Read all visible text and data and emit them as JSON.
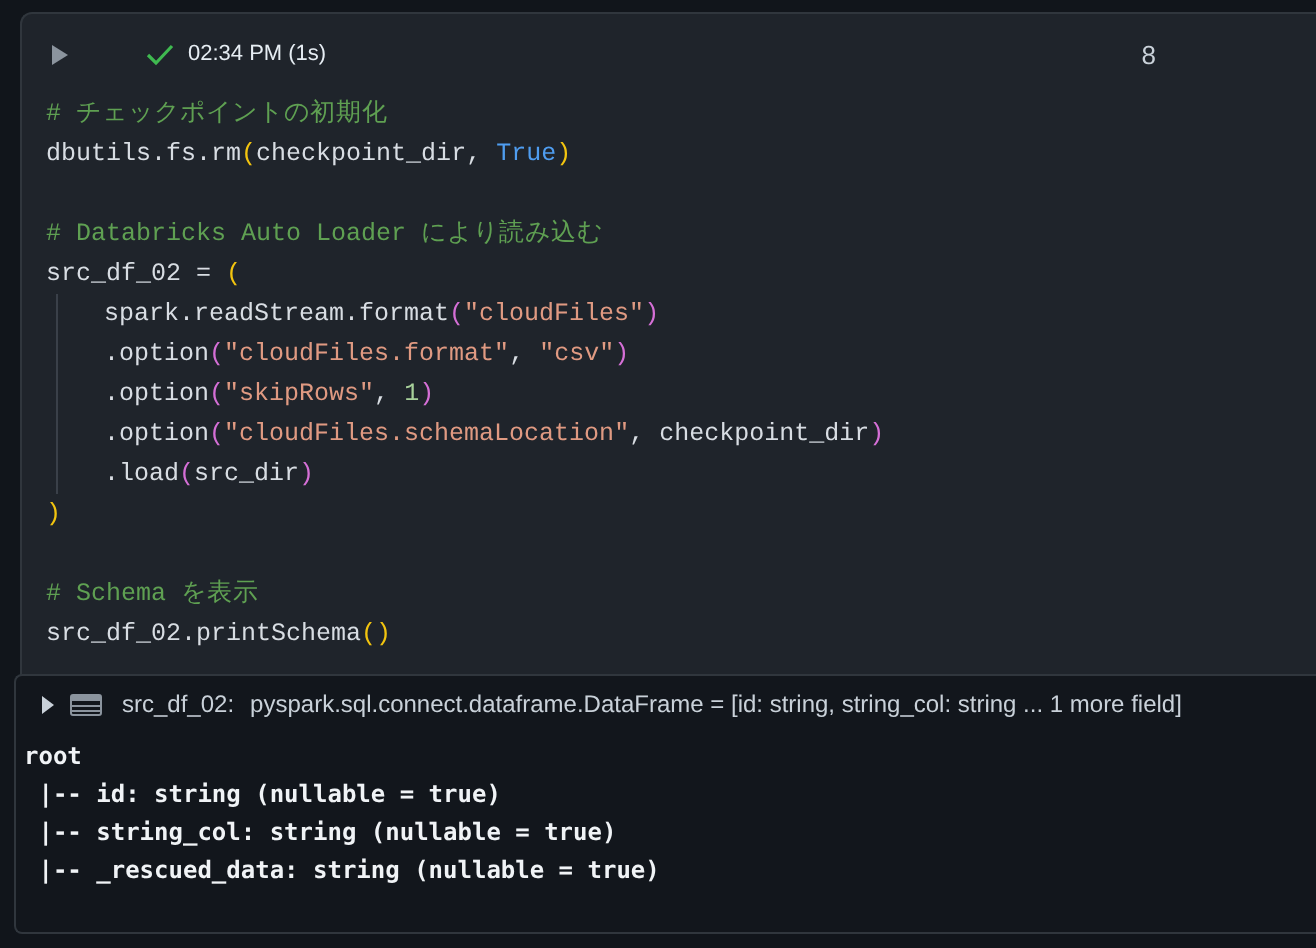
{
  "cell": {
    "succeeded": true,
    "run_time": "02:34 PM (1s)",
    "cell_number": "8",
    "code_lines": [
      {
        "kind": "code",
        "indent": false,
        "tokens": [
          {
            "kind": "comment",
            "text": "# チェックポイントの初期化"
          }
        ]
      },
      {
        "kind": "code",
        "indent": false,
        "tokens": [
          {
            "kind": "plain",
            "text": "dbutils.fs.rm"
          },
          {
            "kind": "paren",
            "text": "("
          },
          {
            "kind": "plain",
            "text": "checkpoint_dir, "
          },
          {
            "kind": "keyword",
            "text": "True"
          },
          {
            "kind": "paren",
            "text": ")"
          }
        ]
      },
      {
        "kind": "blank"
      },
      {
        "kind": "code",
        "indent": false,
        "tokens": [
          {
            "kind": "comment",
            "text": "# Databricks Auto Loader により読み込む"
          }
        ]
      },
      {
        "kind": "code",
        "indent": false,
        "tokens": [
          {
            "kind": "plain",
            "text": "src_df_02 = "
          },
          {
            "kind": "paren",
            "text": "("
          }
        ]
      },
      {
        "kind": "code",
        "indent": true,
        "tokens": [
          {
            "kind": "plain",
            "text": "spark.readStream.format"
          },
          {
            "kind": "paren2",
            "text": "("
          },
          {
            "kind": "string",
            "text": "\"cloudFiles\""
          },
          {
            "kind": "paren2",
            "text": ")"
          }
        ]
      },
      {
        "kind": "code",
        "indent": true,
        "tokens": [
          {
            "kind": "plain",
            "text": ".option"
          },
          {
            "kind": "paren2",
            "text": "("
          },
          {
            "kind": "string",
            "text": "\"cloudFiles.format\""
          },
          {
            "kind": "plain",
            "text": ", "
          },
          {
            "kind": "string",
            "text": "\"csv\""
          },
          {
            "kind": "paren2",
            "text": ")"
          }
        ]
      },
      {
        "kind": "code",
        "indent": true,
        "tokens": [
          {
            "kind": "plain",
            "text": ".option"
          },
          {
            "kind": "paren2",
            "text": "("
          },
          {
            "kind": "string",
            "text": "\"skipRows\""
          },
          {
            "kind": "plain",
            "text": ", "
          },
          {
            "kind": "number",
            "text": "1"
          },
          {
            "kind": "paren2",
            "text": ")"
          }
        ]
      },
      {
        "kind": "code",
        "indent": true,
        "tokens": [
          {
            "kind": "plain",
            "text": ".option"
          },
          {
            "kind": "paren2",
            "text": "("
          },
          {
            "kind": "string",
            "text": "\"cloudFiles.schemaLocation\""
          },
          {
            "kind": "plain",
            "text": ", checkpoint_dir"
          },
          {
            "kind": "paren2",
            "text": ")"
          }
        ]
      },
      {
        "kind": "code",
        "indent": true,
        "tokens": [
          {
            "kind": "plain",
            "text": ".load"
          },
          {
            "kind": "paren2",
            "text": "("
          },
          {
            "kind": "plain",
            "text": "src_dir"
          },
          {
            "kind": "paren2",
            "text": ")"
          }
        ]
      },
      {
        "kind": "code",
        "indent": false,
        "tokens": [
          {
            "kind": "paren",
            "text": ")"
          }
        ]
      },
      {
        "kind": "blank"
      },
      {
        "kind": "code",
        "indent": false,
        "tokens": [
          {
            "kind": "comment",
            "text": "# Schema を表示"
          }
        ]
      },
      {
        "kind": "code",
        "indent": false,
        "tokens": [
          {
            "kind": "plain",
            "text": "src_df_02.printSchema"
          },
          {
            "kind": "paren",
            "text": "()"
          }
        ]
      }
    ],
    "output": {
      "expanded": false,
      "variable": "src_df_02:",
      "type_info": "pyspark.sql.connect.dataframe.DataFrame = [id: string, string_col: string ... 1 more field]",
      "lines": [
        "root",
        " |-- id: string (nullable = true)",
        " |-- string_col: string (nullable = true)",
        " |-- _rescued_data: string (nullable = true)"
      ]
    }
  }
}
